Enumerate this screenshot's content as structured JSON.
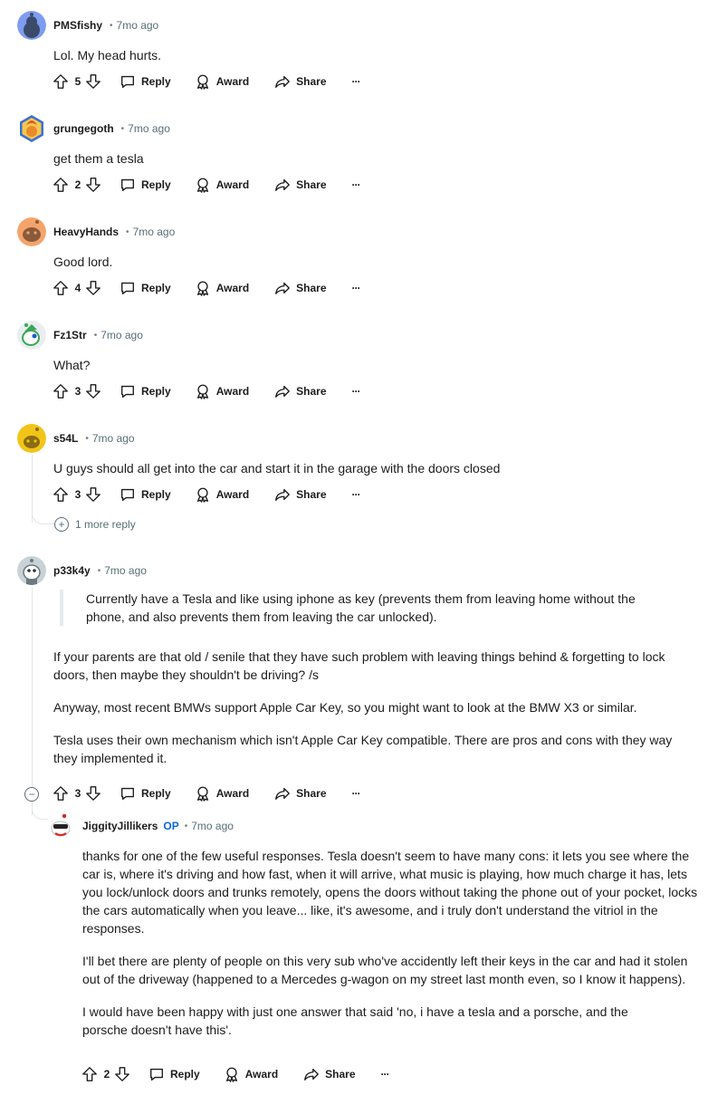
{
  "actions": {
    "reply": "Reply",
    "award": "Award",
    "share": "Share",
    "more": "···"
  },
  "comments": [
    {
      "author": "PMSfishy",
      "time": "7mo ago",
      "text": "Lol. My head hurts.",
      "votes": "5",
      "avatar_color": "#7e9cf0"
    },
    {
      "author": "grungegoth",
      "time": "7mo ago",
      "text": "get them a tesla",
      "votes": "2",
      "avatar_color": "#3b6fd8"
    },
    {
      "author": "HeavyHands",
      "time": "7mo ago",
      "text": "Good lord.",
      "votes": "4",
      "avatar_color": "#f4a46b"
    },
    {
      "author": "Fz1Str",
      "time": "7mo ago",
      "text": "What?",
      "votes": "3",
      "avatar_color": "#e9eef0"
    },
    {
      "author": "s54L",
      "time": "7mo ago",
      "text": "U guys should all get into the car and start it in the garage with the doors closed",
      "votes": "3",
      "avatar_color": "#f2c419",
      "more_replies": "1 more reply"
    },
    {
      "author": "p33k4y",
      "time": "7mo ago",
      "votes": "3",
      "avatar_color": "#c9d2d6",
      "quote": "Currently have a Tesla and like using iphone as key (prevents them from leaving home without the phone, and also prevents them from leaving the car unlocked).",
      "paragraphs": [
        "If your parents are that old / senile that they have such problem with leaving things behind & forgetting to lock doors, then maybe they shouldn't be driving? /s",
        "Anyway, most recent BMWs support Apple Car Key, so you might want to look at the BMW X3 or similar.",
        "Tesla uses their own mechanism which isn't Apple Car Key compatible. There are pros and cons with they way they implemented it."
      ]
    },
    {
      "author": "JiggityJillikers",
      "op_badge": "OP",
      "time": "7mo ago",
      "votes": "2",
      "avatar_color": "#ffffff",
      "paragraphs": [
        "thanks for one of the few useful responses. Tesla doesn't seem to have many cons: it lets you see where the car is, where it's driving and how fast, when it will arrive, what music is playing, how much charge it has, lets you lock/unlock doors and trunks remotely, opens the doors without taking the phone out of your pocket, locks the cars automatically when you leave... like, it's awesome, and i truly don't understand the vitriol in the responses.",
        "I'll bet there are plenty of people on this very sub who've accidently left their keys in the car and had it stolen out of the driveway (happened to a Mercedes g-wagon on my street last month even, so I know it happens).",
        "I would have been happy with just one answer that said 'no, i have a tesla and a porsche, and the porsche doesn't have this'."
      ]
    }
  ]
}
